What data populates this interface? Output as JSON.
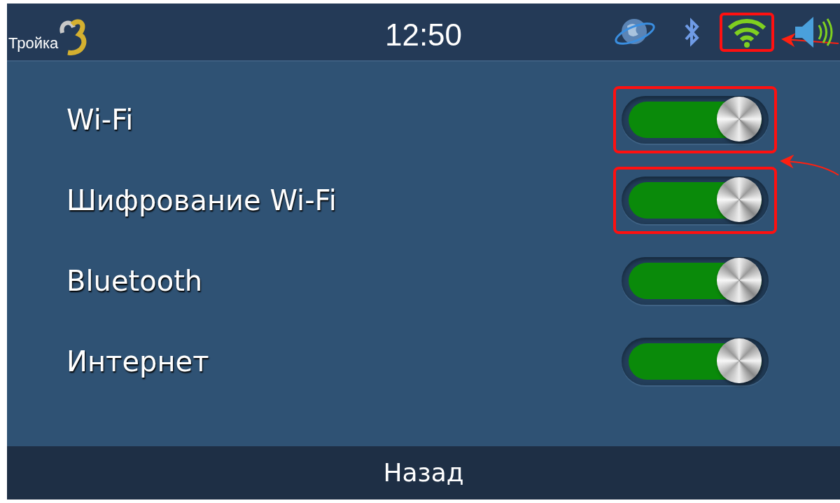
{
  "header": {
    "logo_text": "Тройка",
    "time": "12:50",
    "status_icons": [
      {
        "kind": "globe",
        "highlighted": false
      },
      {
        "kind": "bluetooth",
        "highlighted": false
      },
      {
        "kind": "wifi",
        "highlighted": true
      },
      {
        "kind": "speaker",
        "highlighted": false
      }
    ]
  },
  "settings": [
    {
      "label": "Wi-Fi",
      "on": true,
      "highlighted": true
    },
    {
      "label": "Шифрование Wi-Fi",
      "on": true,
      "highlighted": true
    },
    {
      "label": "Bluetooth",
      "on": true,
      "highlighted": false
    },
    {
      "label": "Интернет",
      "on": true,
      "highlighted": false
    }
  ],
  "footer": {
    "back_button": "Назад"
  }
}
